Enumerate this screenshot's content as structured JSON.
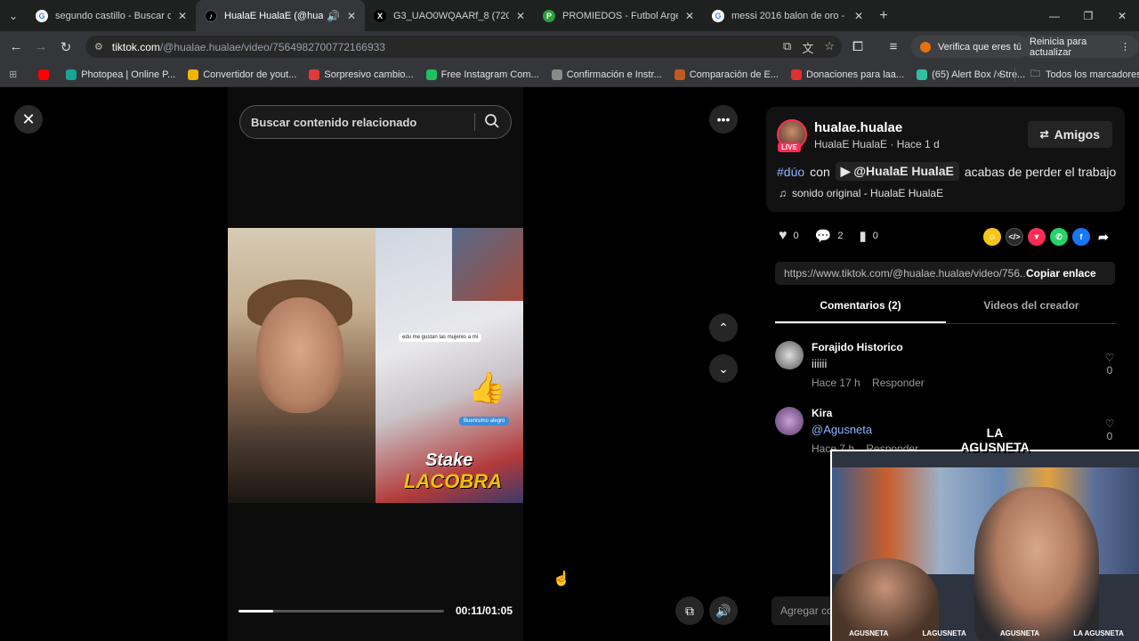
{
  "tabs": [
    {
      "title": "segundo castillo - Buscar con G",
      "icon": "google-icon",
      "active": false
    },
    {
      "title": "HualaE HualaE (@hualae.hu",
      "icon": "tiktok-icon",
      "active": true
    },
    {
      "title": "G3_UAO0WQAARf_8 (720×120",
      "icon": "x-icon",
      "active": false
    },
    {
      "title": "PROMIEDOS - Futbol Argentino",
      "icon": "promiedos-icon",
      "active": false
    },
    {
      "title": "messi 2016 balon de oro - Busc",
      "icon": "google-icon",
      "active": false
    }
  ],
  "omnibox": {
    "domain": "tiktok.com",
    "path": "/@hualae.hualae/video/7564982700772166933"
  },
  "toolbar_pills": {
    "verify": "Verifica que eres tú",
    "restart": "Reinicia para actualizar"
  },
  "bookmarks": [
    {
      "label": "",
      "icon": "youtube-icon",
      "color": "#ff0000"
    },
    {
      "label": "Photopea | Online P...",
      "icon": "photopea-icon",
      "color": "#18a497"
    },
    {
      "label": "Convertidor de yout...",
      "icon": "converter-icon",
      "color": "#f0b400"
    },
    {
      "label": "Sorpresivo cambio...",
      "icon": "news-icon",
      "color": "#e03a3a"
    },
    {
      "label": "Free Instagram Com...",
      "icon": "instagram-tool-icon",
      "color": "#20c060"
    },
    {
      "label": "Confirmación e Instr...",
      "icon": "link-icon",
      "color": "#8a8a8a"
    },
    {
      "label": "Comparación de E...",
      "icon": "compare-icon",
      "color": "#c05a20"
    },
    {
      "label": "Donaciones para laa...",
      "icon": "donation-icon",
      "color": "#e03030"
    },
    {
      "label": "(65) Alert Box / Stre...",
      "icon": "streamlabs-icon",
      "color": "#30c0a0"
    }
  ],
  "bookmarks_all": "Todos los marcadores",
  "search": {
    "placeholder": "Buscar contenido relacionado"
  },
  "video": {
    "chat_line": "edu me gustan las mujeres a mi",
    "blue_msg": "Buenisimo alegro",
    "overlay_1": "Stake",
    "overlay_2": "LACOBRA",
    "progress": 0.17,
    "time": "00:11/01:05"
  },
  "creator": {
    "username": "hualae.hualae",
    "meta": "HualaE HualaE · Hace 1 d",
    "live_badge": "LIVE",
    "follow_label": "Amigos"
  },
  "description": {
    "hashtag": "#dúo",
    "con": "con",
    "mention": "@HualaE HualaE",
    "text": "acabas de perder el trabajo"
  },
  "sound": "sonido original - HualaE HualaE",
  "stats": {
    "likes": "0",
    "comments": "2",
    "saves": "0"
  },
  "share_colors": {
    "friends": "#f5c518",
    "embed": "#2a2a2a",
    "send": "#fe2c55",
    "whatsapp": "#25d366",
    "facebook": "#1877f2"
  },
  "link": {
    "url": "https://www.tiktok.com/@hualae.hualae/video/756...",
    "copy_label": "Copiar enlace"
  },
  "content_tabs": {
    "comments": "Comentarios (2)",
    "creator_videos": "Videos del creador"
  },
  "comments": [
    {
      "name": "Forajido Historico",
      "text": "iiiiii",
      "time": "Hace 17 h",
      "reply": "Responder",
      "likes": "0"
    },
    {
      "name": "Kira",
      "text": "@Agusneta",
      "time": "Hace 7 h",
      "reply": "Responder",
      "likes": "0"
    }
  ],
  "add_comment": "Agregar co",
  "overlay": {
    "logo": "LA AGUSNETA",
    "socials": [
      "AGUSNETA",
      "LAGUSNETA",
      "AGUSNETA",
      "LA AGUSNETA"
    ]
  }
}
